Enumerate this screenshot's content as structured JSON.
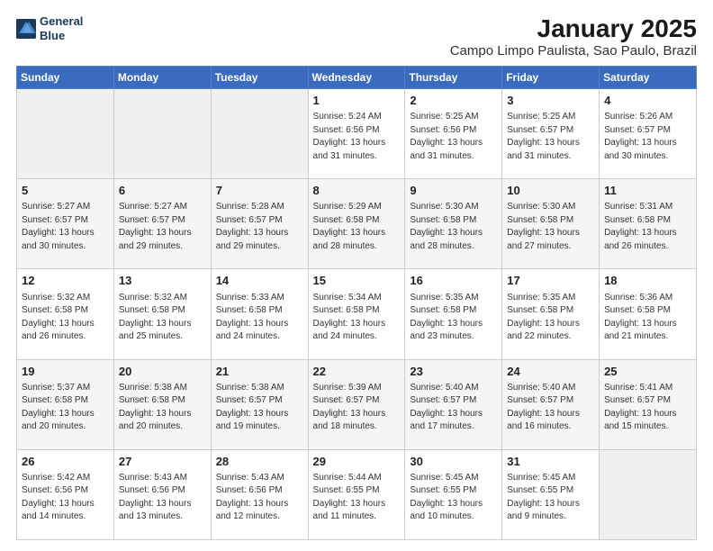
{
  "logo": {
    "text_top": "General",
    "text_bottom": "Blue"
  },
  "title": "January 2025",
  "subtitle": "Campo Limpo Paulista, Sao Paulo, Brazil",
  "weekdays": [
    "Sunday",
    "Monday",
    "Tuesday",
    "Wednesday",
    "Thursday",
    "Friday",
    "Saturday"
  ],
  "weeks": [
    [
      {
        "day": "",
        "info": ""
      },
      {
        "day": "",
        "info": ""
      },
      {
        "day": "",
        "info": ""
      },
      {
        "day": "1",
        "info": "Sunrise: 5:24 AM\nSunset: 6:56 PM\nDaylight: 13 hours\nand 31 minutes."
      },
      {
        "day": "2",
        "info": "Sunrise: 5:25 AM\nSunset: 6:56 PM\nDaylight: 13 hours\nand 31 minutes."
      },
      {
        "day": "3",
        "info": "Sunrise: 5:25 AM\nSunset: 6:57 PM\nDaylight: 13 hours\nand 31 minutes."
      },
      {
        "day": "4",
        "info": "Sunrise: 5:26 AM\nSunset: 6:57 PM\nDaylight: 13 hours\nand 30 minutes."
      }
    ],
    [
      {
        "day": "5",
        "info": "Sunrise: 5:27 AM\nSunset: 6:57 PM\nDaylight: 13 hours\nand 30 minutes."
      },
      {
        "day": "6",
        "info": "Sunrise: 5:27 AM\nSunset: 6:57 PM\nDaylight: 13 hours\nand 29 minutes."
      },
      {
        "day": "7",
        "info": "Sunrise: 5:28 AM\nSunset: 6:57 PM\nDaylight: 13 hours\nand 29 minutes."
      },
      {
        "day": "8",
        "info": "Sunrise: 5:29 AM\nSunset: 6:58 PM\nDaylight: 13 hours\nand 28 minutes."
      },
      {
        "day": "9",
        "info": "Sunrise: 5:30 AM\nSunset: 6:58 PM\nDaylight: 13 hours\nand 28 minutes."
      },
      {
        "day": "10",
        "info": "Sunrise: 5:30 AM\nSunset: 6:58 PM\nDaylight: 13 hours\nand 27 minutes."
      },
      {
        "day": "11",
        "info": "Sunrise: 5:31 AM\nSunset: 6:58 PM\nDaylight: 13 hours\nand 26 minutes."
      }
    ],
    [
      {
        "day": "12",
        "info": "Sunrise: 5:32 AM\nSunset: 6:58 PM\nDaylight: 13 hours\nand 26 minutes."
      },
      {
        "day": "13",
        "info": "Sunrise: 5:32 AM\nSunset: 6:58 PM\nDaylight: 13 hours\nand 25 minutes."
      },
      {
        "day": "14",
        "info": "Sunrise: 5:33 AM\nSunset: 6:58 PM\nDaylight: 13 hours\nand 24 minutes."
      },
      {
        "day": "15",
        "info": "Sunrise: 5:34 AM\nSunset: 6:58 PM\nDaylight: 13 hours\nand 24 minutes."
      },
      {
        "day": "16",
        "info": "Sunrise: 5:35 AM\nSunset: 6:58 PM\nDaylight: 13 hours\nand 23 minutes."
      },
      {
        "day": "17",
        "info": "Sunrise: 5:35 AM\nSunset: 6:58 PM\nDaylight: 13 hours\nand 22 minutes."
      },
      {
        "day": "18",
        "info": "Sunrise: 5:36 AM\nSunset: 6:58 PM\nDaylight: 13 hours\nand 21 minutes."
      }
    ],
    [
      {
        "day": "19",
        "info": "Sunrise: 5:37 AM\nSunset: 6:58 PM\nDaylight: 13 hours\nand 20 minutes."
      },
      {
        "day": "20",
        "info": "Sunrise: 5:38 AM\nSunset: 6:58 PM\nDaylight: 13 hours\nand 20 minutes."
      },
      {
        "day": "21",
        "info": "Sunrise: 5:38 AM\nSunset: 6:57 PM\nDaylight: 13 hours\nand 19 minutes."
      },
      {
        "day": "22",
        "info": "Sunrise: 5:39 AM\nSunset: 6:57 PM\nDaylight: 13 hours\nand 18 minutes."
      },
      {
        "day": "23",
        "info": "Sunrise: 5:40 AM\nSunset: 6:57 PM\nDaylight: 13 hours\nand 17 minutes."
      },
      {
        "day": "24",
        "info": "Sunrise: 5:40 AM\nSunset: 6:57 PM\nDaylight: 13 hours\nand 16 minutes."
      },
      {
        "day": "25",
        "info": "Sunrise: 5:41 AM\nSunset: 6:57 PM\nDaylight: 13 hours\nand 15 minutes."
      }
    ],
    [
      {
        "day": "26",
        "info": "Sunrise: 5:42 AM\nSunset: 6:56 PM\nDaylight: 13 hours\nand 14 minutes."
      },
      {
        "day": "27",
        "info": "Sunrise: 5:43 AM\nSunset: 6:56 PM\nDaylight: 13 hours\nand 13 minutes."
      },
      {
        "day": "28",
        "info": "Sunrise: 5:43 AM\nSunset: 6:56 PM\nDaylight: 13 hours\nand 12 minutes."
      },
      {
        "day": "29",
        "info": "Sunrise: 5:44 AM\nSunset: 6:55 PM\nDaylight: 13 hours\nand 11 minutes."
      },
      {
        "day": "30",
        "info": "Sunrise: 5:45 AM\nSunset: 6:55 PM\nDaylight: 13 hours\nand 10 minutes."
      },
      {
        "day": "31",
        "info": "Sunrise: 5:45 AM\nSunset: 6:55 PM\nDaylight: 13 hours\nand 9 minutes."
      },
      {
        "day": "",
        "info": ""
      }
    ]
  ]
}
